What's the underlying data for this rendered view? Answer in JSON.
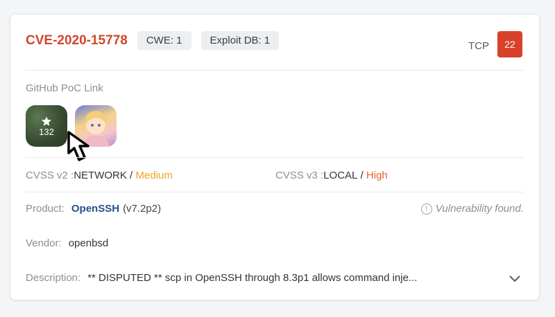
{
  "header": {
    "cve_id": "CVE-2020-15778",
    "chips": [
      "CWE: 1",
      "Exploit DB: 1"
    ],
    "protocol": "TCP",
    "port": "22"
  },
  "github": {
    "label": "GitHub PoC Link",
    "repos": [
      {
        "icon": "star-icon",
        "stars": "132"
      },
      {
        "icon": "anime-avatar"
      }
    ]
  },
  "cvss": {
    "v2_label": "CVSS v2 :",
    "v2_vector": "NETWORK",
    "v2_sep": " / ",
    "v2_severity": "Medium",
    "v3_label": "CVSS v3 :",
    "v3_vector": "LOCAL",
    "v3_sep": " / ",
    "v3_severity": "High"
  },
  "product": {
    "label": "Product:",
    "name": "OpenSSH",
    "version": "(v7.2p2)",
    "status": "Vulnerability found."
  },
  "vendor": {
    "label": "Vendor:",
    "value": "openbsd"
  },
  "description": {
    "label": "Description:",
    "value": "** DISPUTED ** scp in OpenSSH through 8.3p1 allows command inje..."
  },
  "colors": {
    "accent": "#d2452b",
    "medium": "#f0a620",
    "high": "#e8622a",
    "link": "#2a4f8a"
  }
}
